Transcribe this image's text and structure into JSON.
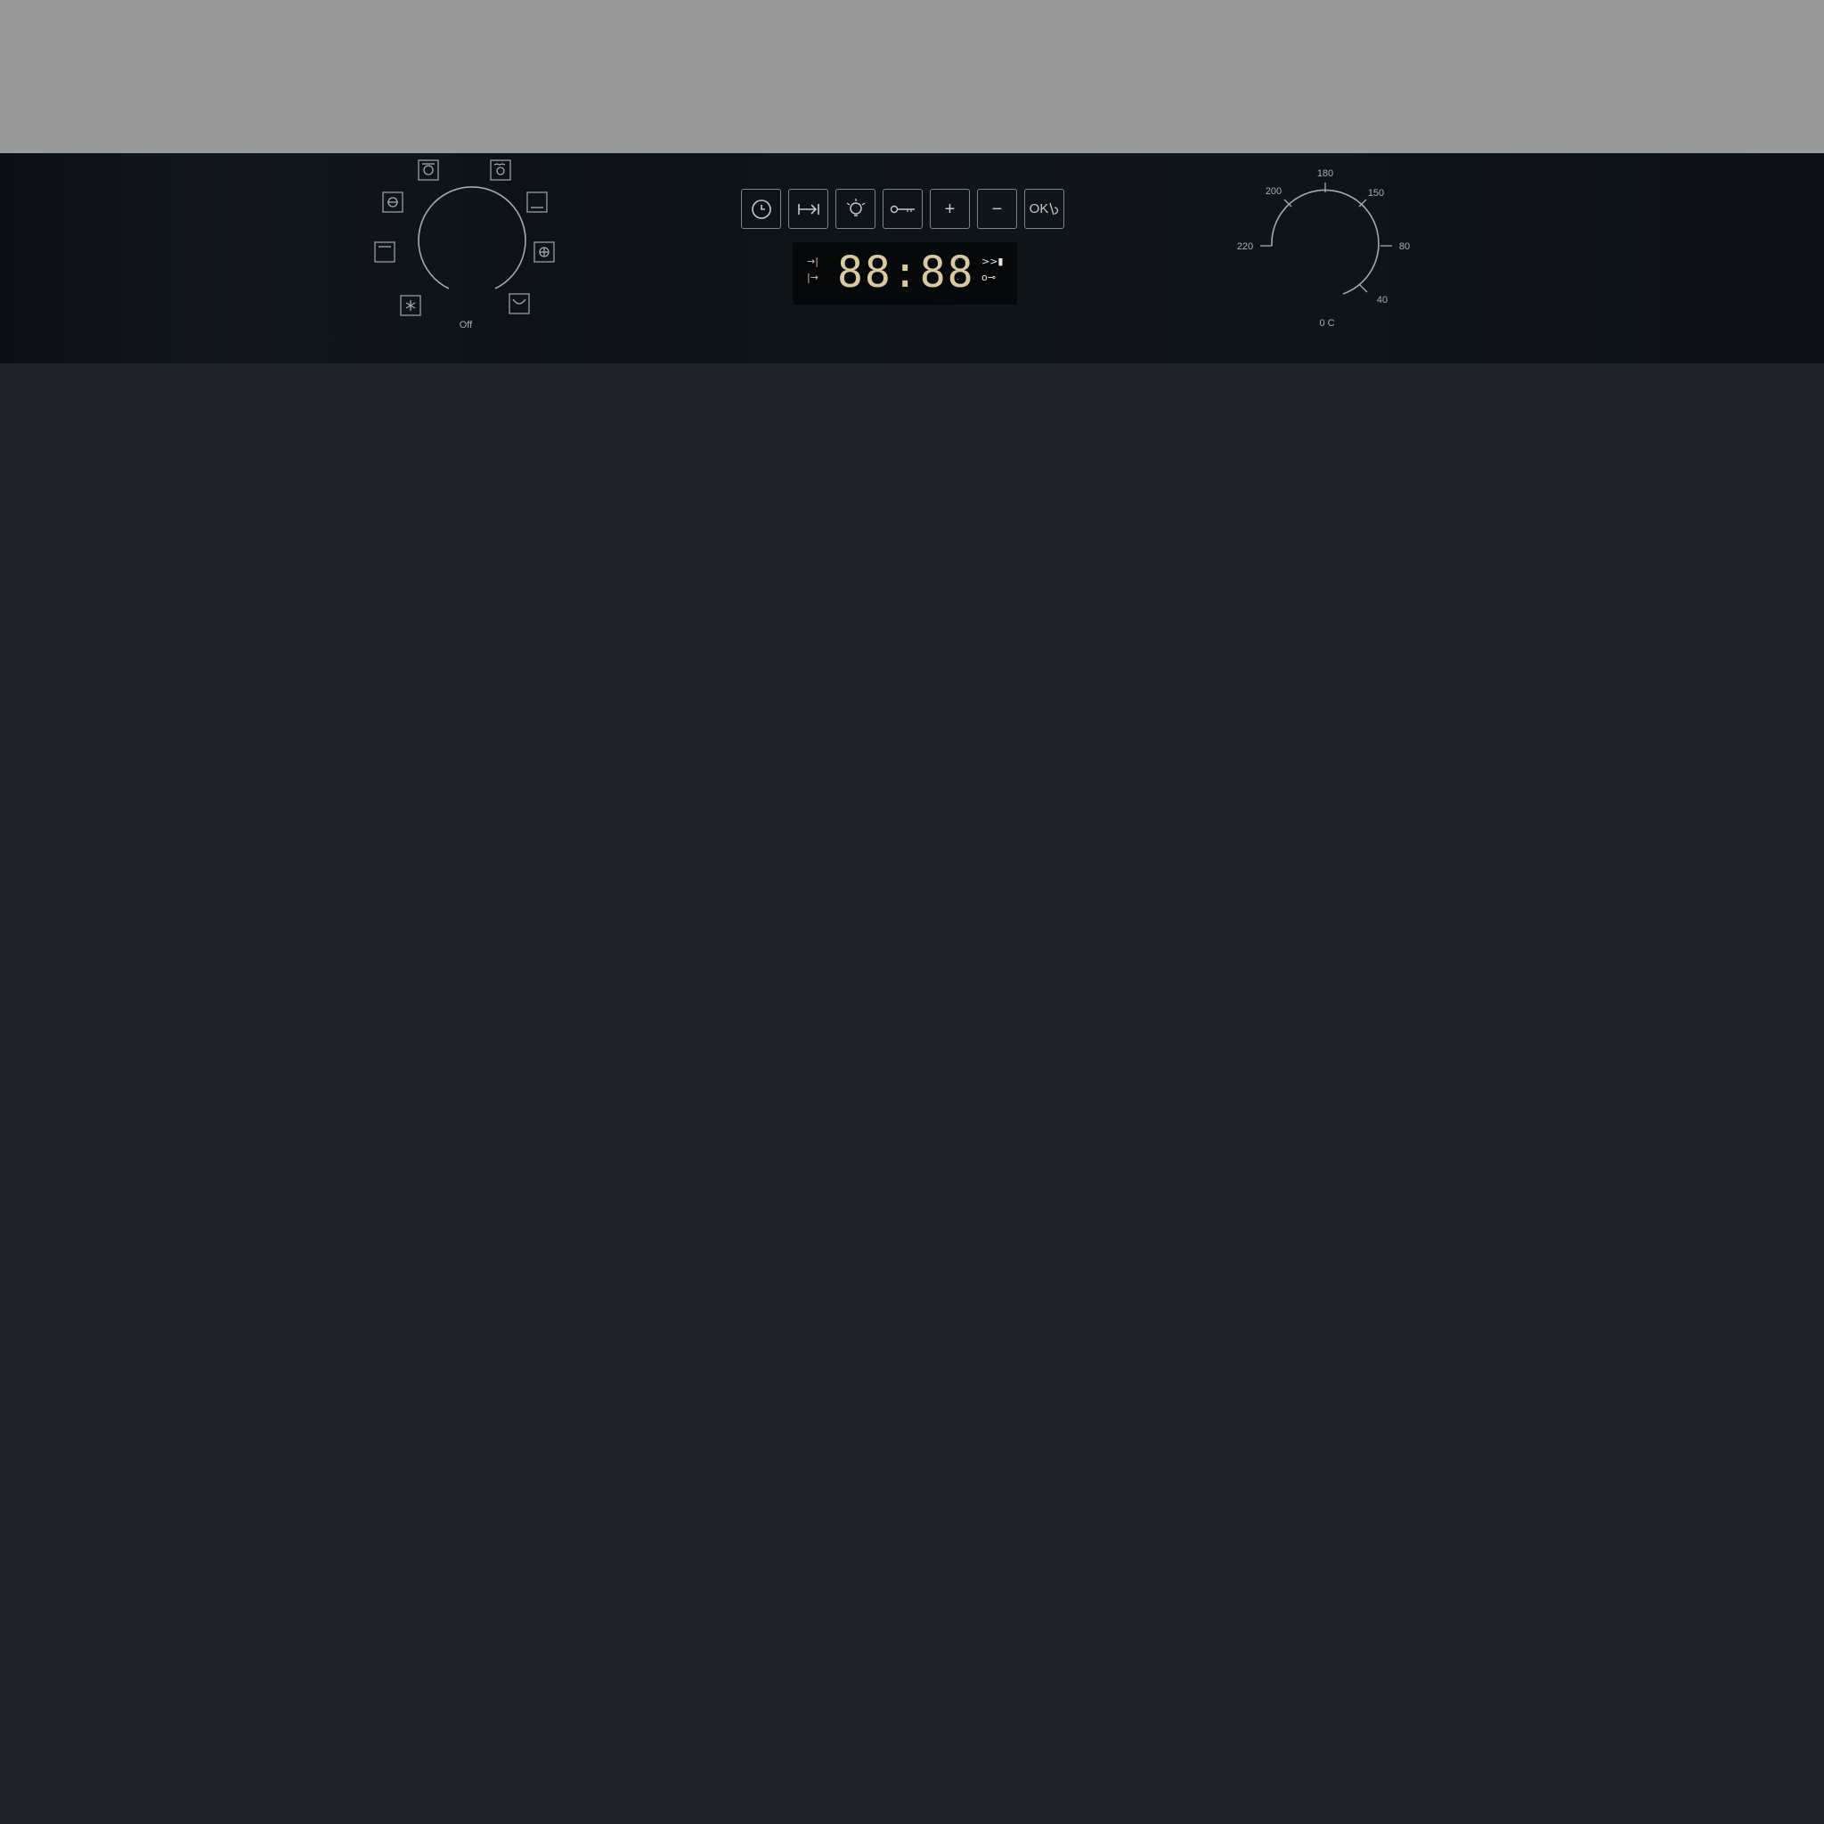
{
  "colors": {
    "top_band": "#999999",
    "panel": "#0e1317",
    "door": "#1f2328",
    "display_digits": "#d9c9a2",
    "markings": "#a7adb3"
  },
  "function_dial": {
    "off_label": "Off",
    "positions": [
      {
        "icon": "fan-oven-icon"
      },
      {
        "icon": "fan-grill-icon"
      },
      {
        "icon": "conventional-heat-icon"
      },
      {
        "icon": "bottom-heat-icon"
      },
      {
        "icon": "fan-heat-icon"
      },
      {
        "icon": "top-heat-icon"
      },
      {
        "icon": "defrost-icon"
      },
      {
        "icon": "grill-icon"
      }
    ]
  },
  "touch_buttons": [
    {
      "name": "clock-button",
      "icon": "clock-icon"
    },
    {
      "name": "cook-time-button",
      "icon": "cook-time-icon"
    },
    {
      "name": "light-button",
      "icon": "light-bulb-icon"
    },
    {
      "name": "child-lock-button",
      "icon": "key-lock-icon"
    },
    {
      "name": "plus-button",
      "label": "+"
    },
    {
      "name": "minus-button",
      "label": "−"
    },
    {
      "name": "ok-button",
      "label": "OK"
    }
  ],
  "display": {
    "time": "88:88",
    "left_icons": [
      "→|",
      "|→"
    ],
    "right_icons": [
      ">>▮",
      "o⊸"
    ]
  },
  "temperature_dial": {
    "unit_label": "0 C",
    "scale": [
      "40",
      "80",
      "150",
      "180",
      "200",
      "220"
    ]
  }
}
